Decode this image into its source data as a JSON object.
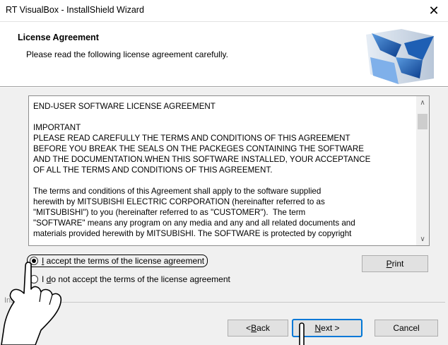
{
  "window": {
    "title": "RT VisualBox - InstallShield Wizard",
    "close_glyph": "✕"
  },
  "header": {
    "title": "License Agreement",
    "subtitle": "Please read the following license agreement carefully."
  },
  "license": {
    "text": "END-USER SOFTWARE LICENSE AGREEMENT\n\nIMPORTANT\nPLEASE READ CAREFULLY THE TERMS AND CONDITIONS OF THIS AGREEMENT\nBEFORE YOU BREAK THE SEALS ON THE PACKEGES CONTAINING THE SOFTWARE\nAND THE DOCUMENTATION.WHEN THIS SOFTWARE INSTALLED, YOUR ACCEPTANCE\nOF ALL THE TERMS AND CONDITIONS OF THIS AGREEMENT.\n\nThe terms and conditions of this Agreement shall apply to the software supplied\nherewith by MITSUBISHI ELECTRIC CORPORATION (hereinafter referred to as\n\"MITSUBISHI\") to you (hereinafter referred to as \"CUSTOMER\").  The term\n\"SOFTWARE\" means any program on any media and any and all related documents and\nmaterials provided herewith by MITSUBISHI. The SOFTWARE is protected by copyright",
    "scroll_up_glyph": "∧",
    "scroll_down_glyph": "∨"
  },
  "options": {
    "accept": {
      "prefix": "",
      "mnemonic": "I",
      "rest": " accept the terms of the license agreement",
      "selected": true
    },
    "decline": {
      "prefix": "I ",
      "mnemonic": "d",
      "rest": "o not accept the terms of the license agreement",
      "selected": false
    }
  },
  "buttons": {
    "print": {
      "mnemonic": "P",
      "rest": "rint"
    },
    "back": {
      "prefix": "< ",
      "mnemonic": "B",
      "rest": "ack"
    },
    "next": {
      "mnemonic": "N",
      "rest": "ext >"
    },
    "cancel": "Cancel"
  },
  "brand": "InstallShield",
  "colors": {
    "accent": "#0078d7",
    "logo_blue": "#1e5fb4"
  }
}
